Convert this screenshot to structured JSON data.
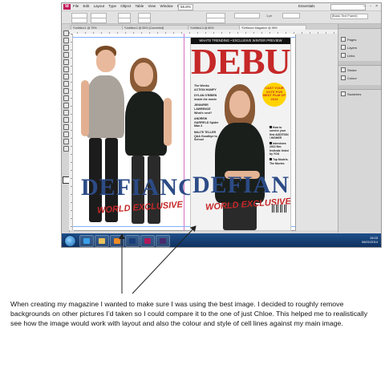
{
  "app": {
    "logo": "Id",
    "menus": [
      "File",
      "Edit",
      "Layout",
      "Type",
      "Object",
      "Table",
      "View",
      "Window",
      "Help"
    ],
    "zoom": "55.8%",
    "workspace": "Essentials",
    "window_controls": "– ▫ ×"
  },
  "control_bar": {
    "font_size": "1 pt",
    "paragraph_style": "[Basic Text Frame]"
  },
  "tabs": [
    "*Untitled-1 @ 75%",
    "*Untitled-2 @ 55% [Converted]",
    "*Untitled-3 @ 80%",
    "*Defiance Magazine @ 56%"
  ],
  "panels": {
    "items": [
      "Pages",
      "Layers",
      "Links",
      "Stroke",
      "Colour",
      "Swatches"
    ]
  },
  "left_page": {
    "title": "DEFIANCE",
    "subtitle": "WORLD EXCLUSIVE"
  },
  "cover": {
    "header": "WHATS TRENDING • EXCLUSIVE WINTER PREVIEW",
    "masthead": "DEBUT",
    "coverlines": [
      "The Weeks ACTION HAMPY",
      "DYLAN O'BRIEN inside the movie",
      "JENNIFER LAWRENCE What's next?",
      "ANDREW GARFIELD Spider Man 3",
      "MALTE TELLER Q&A Goodbye to School"
    ],
    "badge": "CAST YOUR VOTE FOR BEST FILM OF 2013",
    "right_lines": [
      "How to survive your first AUDITION / HIGHER",
      "Interviews 2013 film festivals Voted by YOU",
      "Top Models. The Movies"
    ],
    "title": "DEFIANCE",
    "subtitle": "WORLD EXCLUSIVE"
  },
  "taskbar": {
    "time": "15:03",
    "date": "06/01/2014"
  },
  "caption": "When creating my magazine I wanted to make sure I was using the best image. I decided to roughly remove backgrounds on other pictures I’d taken so I could compare it to the one of just Chloe. This helped me to realistically see how the image would work with layout and also the colour and style of cell lines against my main image.",
  "colors": {
    "masthead_red": "#c62828",
    "defiance_blue": "#2c4b86",
    "badge_yellow": "#ffd400",
    "taskbar_blue": "#1e4f8a"
  }
}
